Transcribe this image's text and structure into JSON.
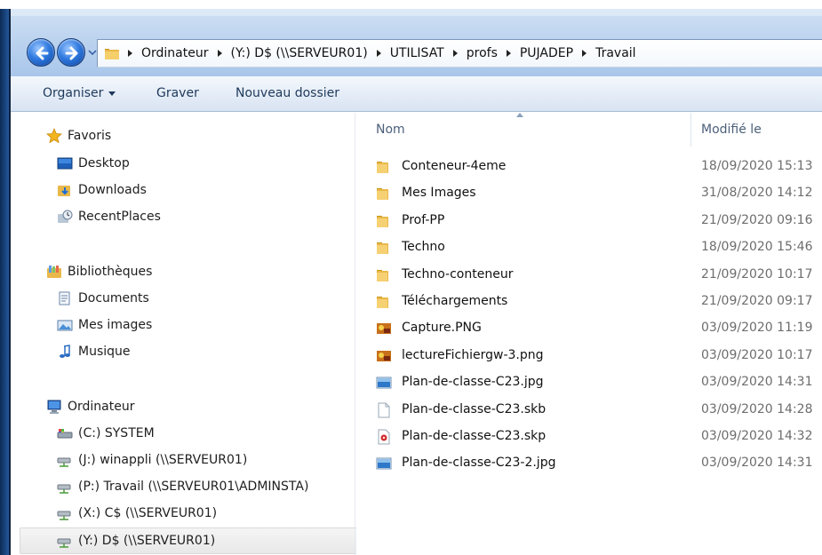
{
  "window": {
    "back_icon": "back-arrow-icon",
    "forward_icon": "forward-arrow-icon"
  },
  "address_bar": {
    "crumbs": [
      "Ordinateur",
      "(Y:) D$ (\\\\SERVEUR01)",
      "UTILISAT",
      "profs",
      "PUJADEP",
      "Travail"
    ]
  },
  "toolbar": {
    "organize_label": "Organiser",
    "burn_label": "Graver",
    "new_folder_label": "Nouveau dossier"
  },
  "nav": {
    "favorites": {
      "label": "Favoris",
      "items": [
        "Desktop",
        "Downloads",
        "RecentPlaces"
      ]
    },
    "libraries": {
      "label": "Bibliothèques",
      "items": [
        "Documents",
        "Mes images",
        "Musique"
      ]
    },
    "computer": {
      "label": "Ordinateur",
      "drives": [
        "(C:) SYSTEM",
        "(J:) winappli (\\\\SERVEUR01)",
        "(P:) Travail (\\\\SERVEUR01\\ADMINSTA)",
        "(X:) C$ (\\\\SERVEUR01)",
        "(Y:) D$ (\\\\SERVEUR01)"
      ],
      "selected_drive": "(Y:) D$ (\\\\SERVEUR01)"
    }
  },
  "file_list": {
    "columns": {
      "name": "Nom",
      "modified": "Modifié le"
    },
    "sort_column": "Nom",
    "files": [
      {
        "name": "Conteneur-4eme",
        "modified": "18/09/2020 15:13",
        "type": "folder"
      },
      {
        "name": "Mes Images",
        "modified": "31/08/2020 14:12",
        "type": "folder"
      },
      {
        "name": "Prof-PP",
        "modified": "21/09/2020 09:16",
        "type": "folder"
      },
      {
        "name": "Techno",
        "modified": "18/09/2020 15:46",
        "type": "folder"
      },
      {
        "name": "Techno-conteneur",
        "modified": "21/09/2020 10:17",
        "type": "folder"
      },
      {
        "name": "Téléchargements",
        "modified": "21/09/2020 09:17",
        "type": "folder"
      },
      {
        "name": "Capture.PNG",
        "modified": "03/09/2020 11:19",
        "type": "png"
      },
      {
        "name": "lectureFichiergw-3.png",
        "modified": "03/09/2020 10:17",
        "type": "png"
      },
      {
        "name": "Plan-de-classe-C23.jpg",
        "modified": "03/09/2020 14:31",
        "type": "jpg"
      },
      {
        "name": "Plan-de-classe-C23.skb",
        "modified": "03/09/2020 14:28",
        "type": "generic"
      },
      {
        "name": "Plan-de-classe-C23.skp",
        "modified": "03/09/2020 14:32",
        "type": "skp"
      },
      {
        "name": "Plan-de-classe-C23-2.jpg",
        "modified": "03/09/2020 14:31",
        "type": "jpg"
      }
    ]
  },
  "colors": {
    "toolbar_text": "#1e395b",
    "header_text": "#4c607a",
    "date_text": "#6d6d6d",
    "frame": "#1b4a86"
  }
}
